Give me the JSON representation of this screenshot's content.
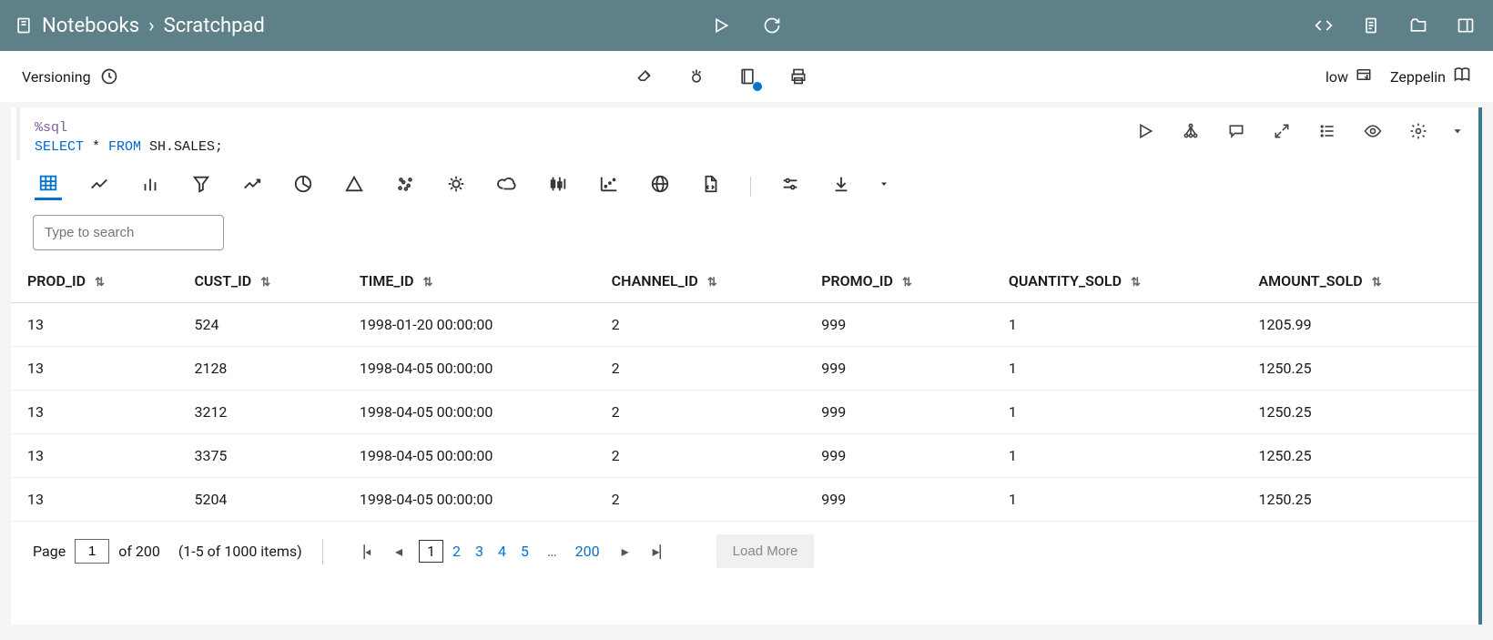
{
  "breadcrumb": {
    "root": "Notebooks",
    "sep": "›",
    "current": "Scratchpad"
  },
  "subbar": {
    "versioning": "Versioning",
    "low": "low",
    "zeppelin": "Zeppelin"
  },
  "code": {
    "magic": "%sql",
    "stmt_kw1": "SELECT",
    "stmt_star": " * ",
    "stmt_kw2": "FROM",
    "stmt_rest": " SH.SALES;"
  },
  "search": {
    "placeholder": "Type to search"
  },
  "table": {
    "columns": [
      "PROD_ID",
      "CUST_ID",
      "TIME_ID",
      "CHANNEL_ID",
      "PROMO_ID",
      "QUANTITY_SOLD",
      "AMOUNT_SOLD"
    ],
    "rows": [
      [
        "13",
        "524",
        "1998-01-20 00:00:00",
        "2",
        "999",
        "1",
        "1205.99"
      ],
      [
        "13",
        "2128",
        "1998-04-05 00:00:00",
        "2",
        "999",
        "1",
        "1250.25"
      ],
      [
        "13",
        "3212",
        "1998-04-05 00:00:00",
        "2",
        "999",
        "1",
        "1250.25"
      ],
      [
        "13",
        "3375",
        "1998-04-05 00:00:00",
        "2",
        "999",
        "1",
        "1250.25"
      ],
      [
        "13",
        "5204",
        "1998-04-05 00:00:00",
        "2",
        "999",
        "1",
        "1250.25"
      ]
    ]
  },
  "pagination": {
    "page_label": "Page",
    "current_page": "1",
    "of_text": "of 200",
    "range_text": "(1-5 of 1000 items)",
    "pages": [
      "1",
      "2",
      "3",
      "4",
      "5"
    ],
    "ellipsis": "…",
    "last_page": "200",
    "load_more": "Load More"
  }
}
